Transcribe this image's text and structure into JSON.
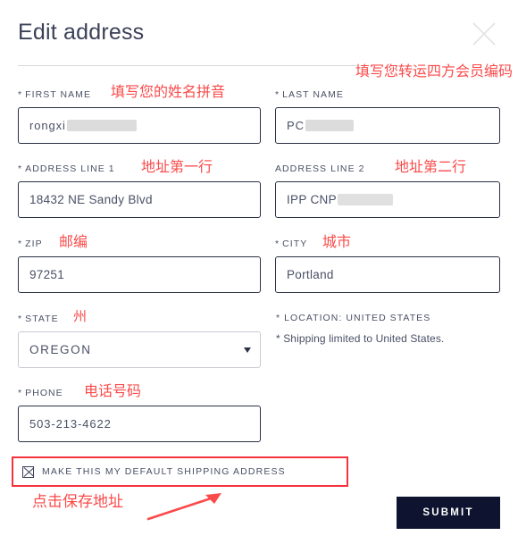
{
  "dialog": {
    "title": "Edit address",
    "close_icon": "close-icon"
  },
  "form": {
    "first_name": {
      "label": "FIRST NAME",
      "required_marker": "*",
      "value": "rongxi",
      "redacted": true,
      "annotation": "填写您的姓名拼音"
    },
    "last_name": {
      "label": "LAST NAME",
      "required_marker": "*",
      "value": "PC",
      "redacted": true,
      "annotation": "填写您转运四方会员编码"
    },
    "address_line_1": {
      "label": "ADDRESS LINE 1",
      "required_marker": "*",
      "value": "18432 NE Sandy Blvd",
      "redacted": false,
      "annotation": "地址第一行"
    },
    "address_line_2": {
      "label": "ADDRESS LINE 2",
      "required_marker": "",
      "value": "IPP CNP",
      "redacted": true,
      "annotation": "地址第二行"
    },
    "zip": {
      "label": "ZIP",
      "required_marker": "*",
      "value": "97251",
      "annotation": "邮编"
    },
    "city": {
      "label": "CITY",
      "required_marker": "*",
      "value": "Portland",
      "annotation": "城市"
    },
    "state": {
      "label": "STATE",
      "required_marker": "*",
      "value": "OREGON",
      "annotation": "州",
      "options": [
        "OREGON"
      ]
    },
    "location": {
      "label": "* LOCATION: UNITED STATES",
      "note": "* Shipping limited to United States."
    },
    "phone": {
      "label": "PHONE",
      "required_marker": "*",
      "value": "503-213-4622",
      "annotation": "电话号码"
    },
    "default_shipping": {
      "label": "MAKE THIS MY DEFAULT SHIPPING ADDRESS",
      "checked": true
    },
    "submit": {
      "label": "SUBMIT",
      "annotation": "点击保存地址"
    }
  },
  "colors": {
    "annotation_red": "#fb4a4a",
    "highlight_box_red": "#f5333f",
    "submit_bg": "#0e1430",
    "text": "#4a5066",
    "title": "#3b4157",
    "input_border": "#2b3044",
    "select_border": "#c9cbd2",
    "divider": "#d9dade",
    "redaction": "#dcdcdc"
  }
}
